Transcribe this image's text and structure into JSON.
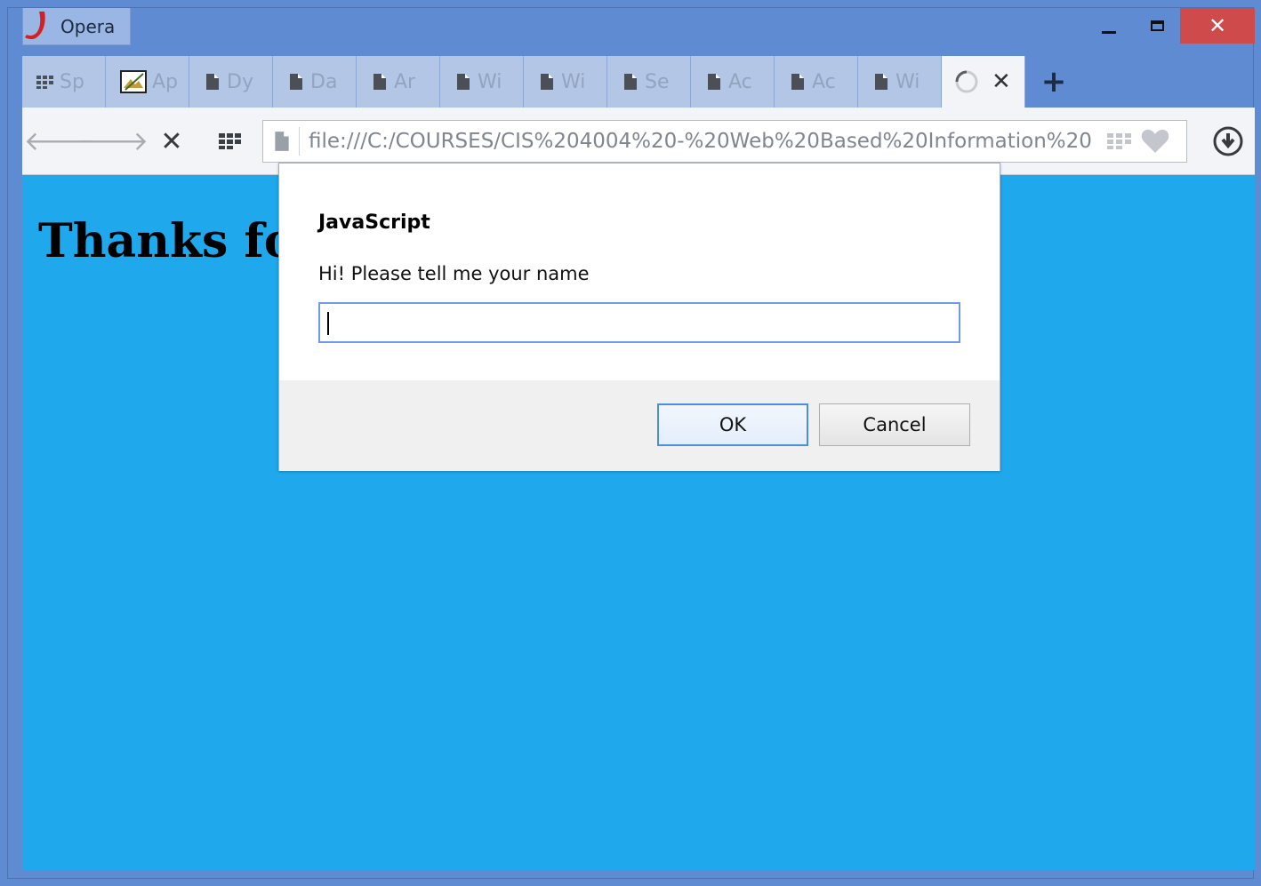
{
  "browser": {
    "name": "Opera",
    "close_glyph": "✕",
    "tabs": [
      {
        "label": "Sp",
        "icon": "speed-dial-icon"
      },
      {
        "label": "Ap",
        "icon": "image-icon"
      },
      {
        "label": "Dy",
        "icon": "page-icon"
      },
      {
        "label": "Da",
        "icon": "page-icon"
      },
      {
        "label": "Ar",
        "icon": "page-icon"
      },
      {
        "label": "Wi",
        "icon": "page-icon"
      },
      {
        "label": "Wi",
        "icon": "page-icon"
      },
      {
        "label": "Se",
        "icon": "page-icon"
      },
      {
        "label": "Ac",
        "icon": "page-icon"
      },
      {
        "label": "Ac",
        "icon": "page-icon"
      },
      {
        "label": "Wi",
        "icon": "page-icon"
      }
    ],
    "active_tab": {
      "close_glyph": "✕",
      "icon": "loading-spinner-icon"
    },
    "new_tab_glyph": "+",
    "address": "file:///C:/COURSES/CIS%204004%20-%20Web%20Based%20Information%20",
    "toolbar": {
      "back_glyph": "🡐",
      "forward_glyph": "🡒",
      "stop_glyph": "✕"
    }
  },
  "page": {
    "heading": "Thanks fo",
    "background": "#1fa8ec"
  },
  "dialog": {
    "title": "JavaScript",
    "message": "Hi!  Please tell me your name",
    "input_value": "",
    "ok_label": "OK",
    "cancel_label": "Cancel"
  }
}
